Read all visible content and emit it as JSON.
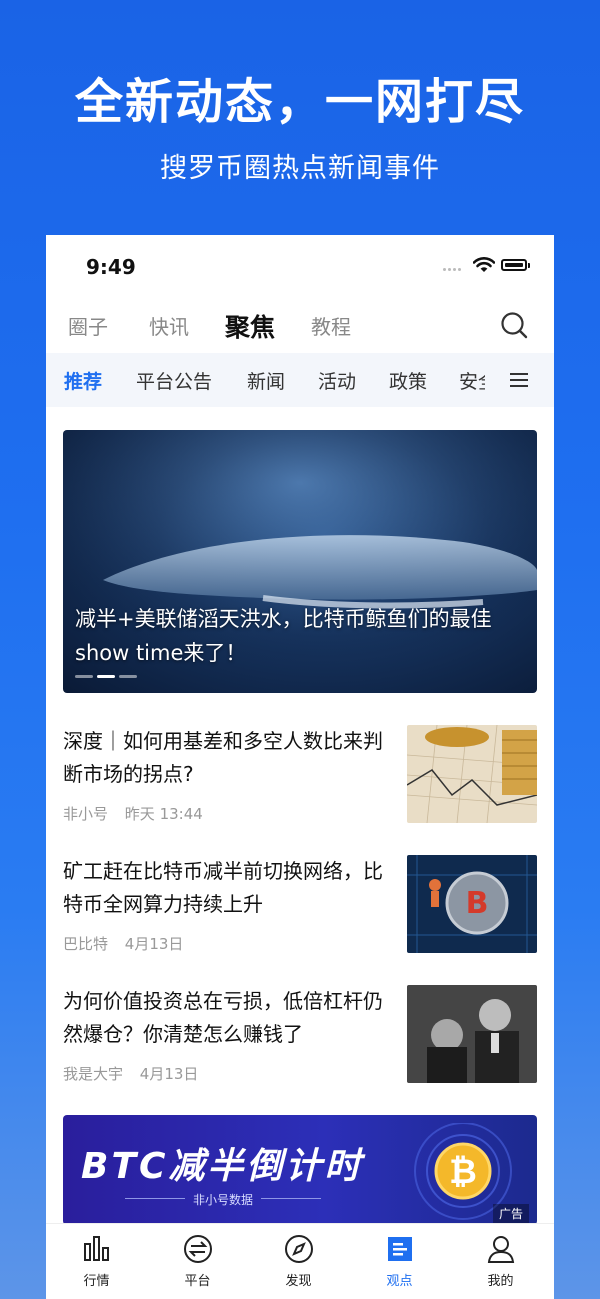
{
  "promo": {
    "title": "全新动态，一网打尽",
    "subtitle": "搜罗币圈热点新闻事件"
  },
  "status_bar": {
    "time": "9:49"
  },
  "top_tabs": [
    {
      "label": "圈子",
      "active": false
    },
    {
      "label": "快讯",
      "active": false
    },
    {
      "label": "聚焦",
      "active": true
    },
    {
      "label": "教程",
      "active": false
    }
  ],
  "categories": [
    {
      "label": "推荐",
      "active": true
    },
    {
      "label": "平台公告",
      "active": false
    },
    {
      "label": "新闻",
      "active": false
    },
    {
      "label": "活动",
      "active": false
    },
    {
      "label": "政策",
      "active": false
    },
    {
      "label": "安全",
      "active": false
    }
  ],
  "hero": {
    "caption": "减半+美联储滔天洪水，比特币鲸鱼们的最佳show time来了！",
    "slides": 3,
    "active_slide": 2
  },
  "articles": [
    {
      "title": "深度｜如何用基差和多空人数比来判断市场的拐点?",
      "source": "非小号",
      "time": "昨天 13:44"
    },
    {
      "title": "矿工赶在比特币减半前切换网络，比特币全网算力持续上升",
      "source": "巴比特",
      "time": "4月13日"
    },
    {
      "title": "为何价值投资总在亏损，低倍杠杆仍然爆仓？你清楚怎么赚钱了",
      "source": "我是大宇",
      "time": "4月13日"
    }
  ],
  "ad": {
    "headline": "BTC减半倒计时",
    "sub": "非小号数据",
    "tag": "广告",
    "coin_symbol": "₿"
  },
  "bottom_nav": [
    {
      "label": "行情",
      "icon": "bar-chart-icon",
      "active": false
    },
    {
      "label": "平台",
      "icon": "exchange-icon",
      "active": false
    },
    {
      "label": "发现",
      "icon": "compass-icon",
      "active": false
    },
    {
      "label": "观点",
      "icon": "viewpoint-icon",
      "active": true
    },
    {
      "label": "我的",
      "icon": "user-icon",
      "active": false
    }
  ],
  "colors": {
    "accent": "#1f6ff0",
    "background": "#1f6ff0"
  }
}
